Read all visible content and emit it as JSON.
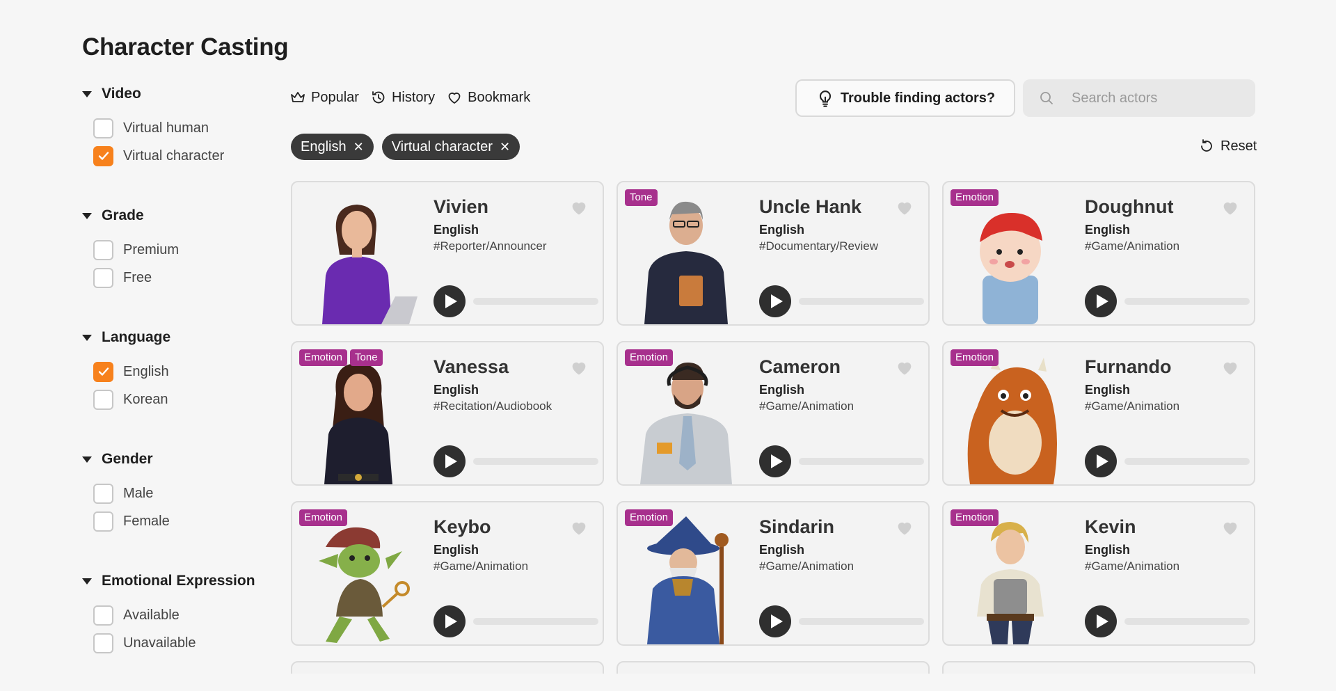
{
  "page": {
    "title": "Character Casting"
  },
  "filters": [
    {
      "title": "Video",
      "options": [
        {
          "label": "Virtual human",
          "checked": false
        },
        {
          "label": "Virtual character",
          "checked": true
        }
      ]
    },
    {
      "title": "Grade",
      "options": [
        {
          "label": "Premium",
          "checked": false
        },
        {
          "label": "Free",
          "checked": false
        }
      ]
    },
    {
      "title": "Language",
      "options": [
        {
          "label": "English",
          "checked": true
        },
        {
          "label": "Korean",
          "checked": false
        }
      ]
    },
    {
      "title": "Gender",
      "options": [
        {
          "label": "Male",
          "checked": false
        },
        {
          "label": "Female",
          "checked": false
        }
      ]
    },
    {
      "title": "Emotional Expression",
      "options": [
        {
          "label": "Available",
          "checked": false
        },
        {
          "label": "Unavailable",
          "checked": false
        }
      ]
    }
  ],
  "toolbar": {
    "popular": "Popular",
    "history": "History",
    "bookmark": "Bookmark",
    "trouble": "Trouble finding actors?",
    "search_placeholder": "Search actors",
    "reset": "Reset"
  },
  "chips": [
    {
      "label": "English"
    },
    {
      "label": "Virtual character"
    }
  ],
  "colors": {
    "accent": "#f7811c",
    "badge": "#a7308d",
    "chip": "#3a3a3a"
  },
  "actors": [
    {
      "name": "Vivien",
      "language": "English",
      "tag": "#Reporter/Announcer",
      "badges": [],
      "progress": 0
    },
    {
      "name": "Uncle Hank",
      "language": "English",
      "tag": "#Documentary/Review",
      "badges": [
        "Tone"
      ],
      "progress": 0
    },
    {
      "name": "Doughnut",
      "language": "English",
      "tag": "#Game/Animation",
      "badges": [
        "Emotion"
      ],
      "progress": 0
    },
    {
      "name": "Vanessa",
      "language": "English",
      "tag": "#Recitation/Audiobook",
      "badges": [
        "Emotion",
        "Tone"
      ],
      "progress": 0
    },
    {
      "name": "Cameron",
      "language": "English",
      "tag": "#Game/Animation",
      "badges": [
        "Emotion"
      ],
      "progress": 0
    },
    {
      "name": "Furnando",
      "language": "English",
      "tag": "#Game/Animation",
      "badges": [
        "Emotion"
      ],
      "progress": 0
    },
    {
      "name": "Keybo",
      "language": "English",
      "tag": "#Game/Animation",
      "badges": [
        "Emotion"
      ],
      "progress": 0
    },
    {
      "name": "Sindarin",
      "language": "English",
      "tag": "#Game/Animation",
      "badges": [
        "Emotion"
      ],
      "progress": 0
    },
    {
      "name": "Kevin",
      "language": "English",
      "tag": "#Game/Animation",
      "badges": [
        "Emotion"
      ],
      "progress": 0
    }
  ]
}
